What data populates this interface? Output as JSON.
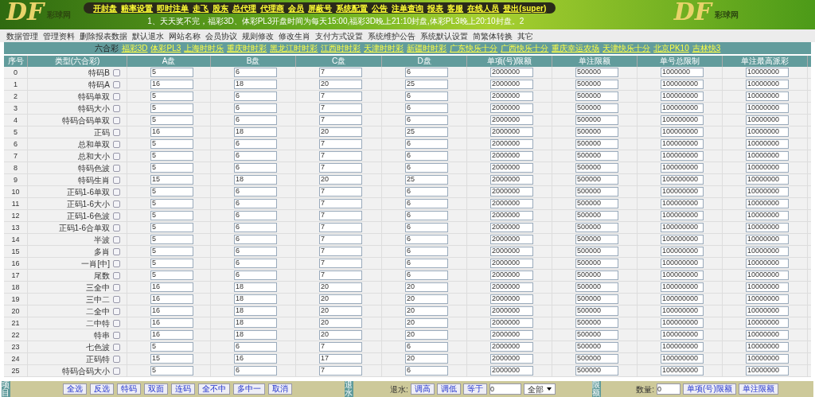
{
  "header": {
    "logos": [
      {
        "mark": "DF",
        "caption": "彩球网"
      },
      {
        "mark": "DF",
        "caption": "彩球网"
      }
    ],
    "menu": [
      "开封盘",
      "赔率设置",
      "即时注单",
      "走飞",
      "股东",
      "总代理",
      "代理商",
      "会员",
      "屏蔽号",
      "系统配置",
      "公告",
      "注单查询",
      "报表",
      "客服",
      "在线人员",
      "登出(super)"
    ],
    "notice": "1、天天奖不完，福彩3D、体彩PL3开盘时间为每天15:00,福彩3D晚上21:10封盘,体彩PL3晚上20:10封盘。2"
  },
  "toolbar": [
    "数据管理",
    "管理资料",
    "删除报表数据",
    "默认退水",
    "网站名称",
    "会员协议",
    "规则修改",
    "修改生肖",
    "支付方式设置",
    "系统维护公告",
    "系统默认设置",
    "简繁体转换",
    "其它"
  ],
  "games": {
    "current": "六合彩",
    "links": [
      "福彩3D",
      "体彩PL3",
      "上海时时乐",
      "重庆时时彩",
      "黑龙江时时彩",
      "江西时时彩",
      "天津时时彩",
      "新疆时时彩",
      "广东快乐十分",
      "广西快乐十分",
      "重庆幸运农场",
      "天津快乐十分",
      "北京PK10",
      "吉林快3"
    ]
  },
  "table": {
    "columns": [
      "序号",
      "类型(六合彩)",
      "A盘",
      "B盘",
      "C盘",
      "D盘",
      "单项(号)限额",
      "单注限额",
      "单号总限制",
      "单注最高派彩"
    ],
    "rows": [
      {
        "no": "0",
        "type": "特码B",
        "checked": false,
        "values": [
          "5",
          "6",
          "7",
          "6",
          "2000000",
          "500000",
          "1000000",
          "10000000"
        ]
      },
      {
        "no": "1",
        "type": "特码A",
        "checked": false,
        "values": [
          "16",
          "18",
          "20",
          "25",
          "2000000",
          "500000",
          "100000000",
          "10000000"
        ]
      },
      {
        "no": "2",
        "type": "特码单双",
        "checked": false,
        "values": [
          "5",
          "6",
          "7",
          "6",
          "2000000",
          "500000",
          "100000000",
          "10000000"
        ]
      },
      {
        "no": "3",
        "type": "特码大小",
        "checked": false,
        "values": [
          "5",
          "6",
          "7",
          "6",
          "2000000",
          "500000",
          "100000000",
          "10000000"
        ]
      },
      {
        "no": "4",
        "type": "特码合码单双",
        "checked": false,
        "values": [
          "5",
          "6",
          "7",
          "6",
          "2000000",
          "500000",
          "100000000",
          "10000000"
        ]
      },
      {
        "no": "5",
        "type": "正码",
        "checked": false,
        "values": [
          "16",
          "18",
          "20",
          "25",
          "2000000",
          "500000",
          "100000000",
          "10000000"
        ]
      },
      {
        "no": "6",
        "type": "总和单双",
        "checked": false,
        "values": [
          "5",
          "6",
          "7",
          "6",
          "2000000",
          "500000",
          "100000000",
          "10000000"
        ]
      },
      {
        "no": "7",
        "type": "总和大小",
        "checked": false,
        "values": [
          "5",
          "6",
          "7",
          "6",
          "2000000",
          "500000",
          "100000000",
          "10000000"
        ]
      },
      {
        "no": "8",
        "type": "特码色波",
        "checked": false,
        "values": [
          "5",
          "6",
          "7",
          "6",
          "2000000",
          "500000",
          "100000000",
          "10000000"
        ]
      },
      {
        "no": "9",
        "type": "特码生肖",
        "checked": false,
        "values": [
          "15",
          "18",
          "20",
          "25",
          "2000000",
          "500000",
          "100000000",
          "10000000"
        ]
      },
      {
        "no": "10",
        "type": "正码1-6单双",
        "checked": false,
        "values": [
          "5",
          "6",
          "7",
          "6",
          "2000000",
          "500000",
          "100000000",
          "10000000"
        ]
      },
      {
        "no": "11",
        "type": "正码1-6大小",
        "checked": false,
        "values": [
          "5",
          "6",
          "7",
          "6",
          "2000000",
          "500000",
          "100000000",
          "10000000"
        ]
      },
      {
        "no": "12",
        "type": "正码1-6色波",
        "checked": false,
        "values": [
          "5",
          "6",
          "7",
          "6",
          "2000000",
          "500000",
          "100000000",
          "10000000"
        ]
      },
      {
        "no": "13",
        "type": "正码1-6合单双",
        "checked": false,
        "values": [
          "5",
          "6",
          "7",
          "6",
          "2000000",
          "500000",
          "100000000",
          "10000000"
        ]
      },
      {
        "no": "14",
        "type": "半波",
        "checked": false,
        "values": [
          "5",
          "6",
          "7",
          "6",
          "2000000",
          "500000",
          "100000000",
          "10000000"
        ]
      },
      {
        "no": "15",
        "type": "多肖",
        "checked": false,
        "values": [
          "5",
          "6",
          "7",
          "6",
          "2000000",
          "500000",
          "100000000",
          "10000000"
        ]
      },
      {
        "no": "16",
        "type": "一肖[中]",
        "checked": false,
        "values": [
          "5",
          "6",
          "7",
          "6",
          "2000000",
          "500000",
          "100000000",
          "10000000"
        ]
      },
      {
        "no": "17",
        "type": "尾数",
        "checked": false,
        "values": [
          "5",
          "6",
          "7",
          "6",
          "2000000",
          "500000",
          "100000000",
          "10000000"
        ]
      },
      {
        "no": "18",
        "type": "三全中",
        "checked": false,
        "values": [
          "16",
          "18",
          "20",
          "20",
          "2000000",
          "500000",
          "100000000",
          "10000000"
        ]
      },
      {
        "no": "19",
        "type": "三中二",
        "checked": false,
        "values": [
          "16",
          "18",
          "20",
          "20",
          "2000000",
          "500000",
          "100000000",
          "10000000"
        ]
      },
      {
        "no": "20",
        "type": "二全中",
        "checked": false,
        "values": [
          "16",
          "18",
          "20",
          "20",
          "2000000",
          "500000",
          "100000000",
          "10000000"
        ]
      },
      {
        "no": "21",
        "type": "二中特",
        "checked": false,
        "values": [
          "16",
          "18",
          "20",
          "20",
          "2000000",
          "500000",
          "100000000",
          "10000000"
        ]
      },
      {
        "no": "22",
        "type": "特串",
        "checked": false,
        "values": [
          "16",
          "18",
          "20",
          "20",
          "2000000",
          "500000",
          "100000000",
          "10000000"
        ]
      },
      {
        "no": "23",
        "type": "七色波",
        "checked": false,
        "values": [
          "5",
          "6",
          "7",
          "6",
          "2000000",
          "500000",
          "100000000",
          "10000000"
        ]
      },
      {
        "no": "24",
        "type": "正码特",
        "checked": false,
        "values": [
          "15",
          "16",
          "17",
          "20",
          "2000000",
          "500000",
          "100000000",
          "10000000"
        ]
      },
      {
        "no": "25",
        "type": "特码合码大小",
        "checked": false,
        "values": [
          "5",
          "6",
          "7",
          "6",
          "2000000",
          "500000",
          "100000000",
          "10000000"
        ]
      }
    ]
  },
  "bottom": {
    "items": {
      "tab": "项目",
      "buttons": [
        "全选",
        "反选",
        "特码",
        "双面",
        "连码",
        "全不中",
        "多中一",
        "取消"
      ]
    },
    "rebate": {
      "tab": "退水",
      "label": "退水:",
      "buttons": [
        "调高",
        "调低",
        "等于"
      ],
      "value": "0",
      "select": "全部"
    },
    "limit": {
      "tab": "限额",
      "label": "数量:",
      "value": "0",
      "buttons": [
        "单项(号)限额",
        "单注限额"
      ]
    }
  }
}
